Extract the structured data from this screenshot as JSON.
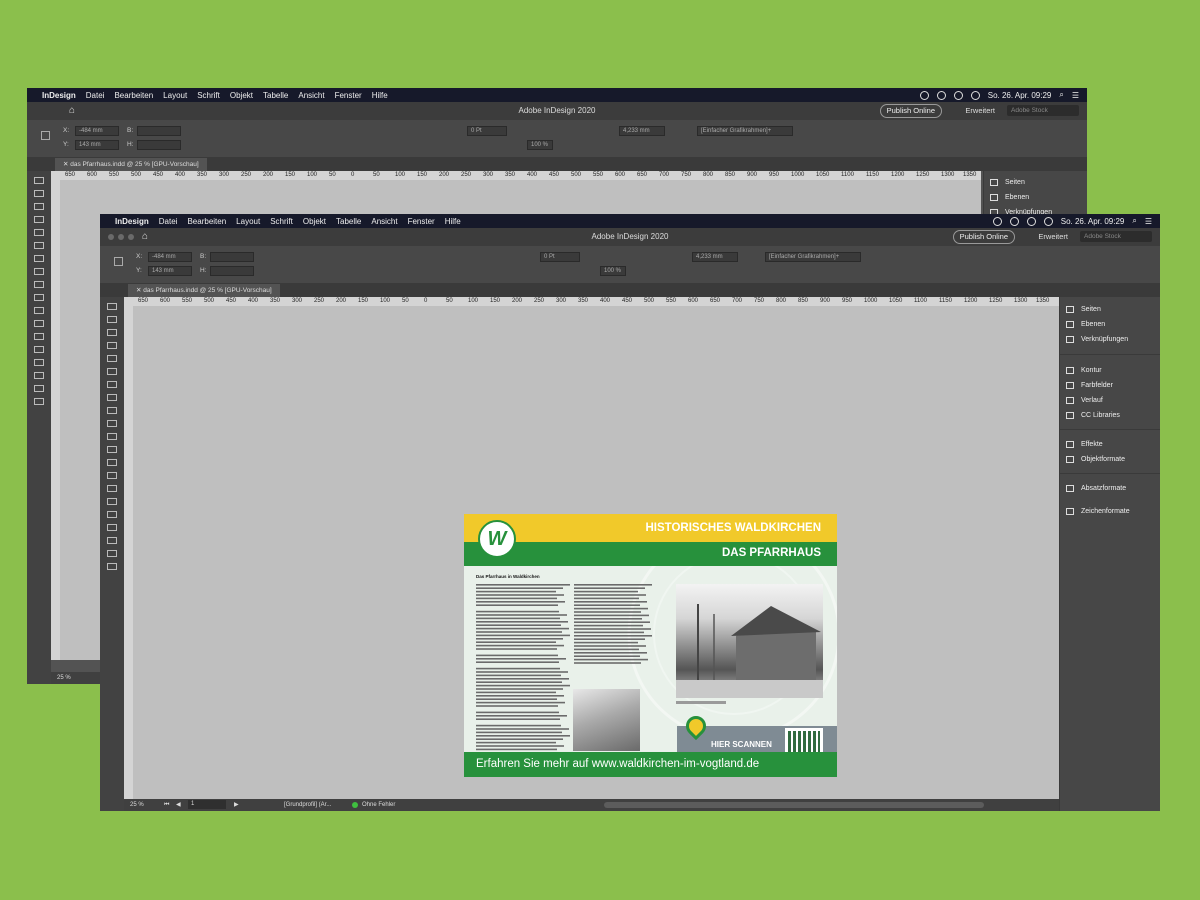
{
  "menubar": {
    "app": "InDesign",
    "items": [
      "Datei",
      "Bearbeiten",
      "Layout",
      "Schrift",
      "Objekt",
      "Tabelle",
      "Ansicht",
      "Fenster",
      "Hilfe"
    ],
    "clock": "So. 26. Apr.  09:29"
  },
  "titlebar": {
    "title": "Adobe InDesign 2020",
    "publish": "Publish Online",
    "workspace": "Erweitert",
    "search_placeholder": "Adobe Stock"
  },
  "control": {
    "x_label": "X:",
    "x_value": "-484 mm",
    "y_label": "Y:",
    "y_value": "143 mm",
    "w_label": "B:",
    "h_label": "H:",
    "stroke_weight": "0 Pt",
    "zoom_box": "100 %",
    "gap": "4,233 mm",
    "object_style": "[Einfacher Grafikrahmen]+"
  },
  "document_tab": "das Pfarrhaus.indd @ 25 % [GPU-Vorschau]",
  "ruler_ticks": [
    "650",
    "600",
    "550",
    "500",
    "450",
    "400",
    "350",
    "300",
    "250",
    "200",
    "150",
    "100",
    "50",
    "0",
    "50",
    "100",
    "150",
    "200",
    "250",
    "300",
    "350",
    "400",
    "450",
    "500",
    "550",
    "600",
    "650",
    "700",
    "750",
    "800",
    "850",
    "900",
    "950",
    "1000",
    "1050",
    "1100",
    "1150",
    "1200",
    "1250",
    "1300",
    "1350"
  ],
  "panels_back": [
    "Seiten",
    "Ebenen",
    "Verknüpfungen"
  ],
  "panels_front": [
    "Seiten",
    "Ebenen",
    "Verknüpfungen",
    "Kontur",
    "Farbfelder",
    "Verlauf",
    "CC Libraries",
    "Effekte",
    "Objektformate",
    "Absatzformate",
    "Zeichenformate"
  ],
  "status": {
    "zoom": "25 %",
    "page": "1",
    "profile": "[Grundprofil] (Ar...",
    "preflight": "Ohne Fehler"
  },
  "poster": {
    "title": "HISTORISCHES WALDKIRCHEN",
    "subtitle": "DAS PFARRHAUS",
    "heading": "Das Pfarrhaus in Waldkirchen",
    "logo_letter": "W",
    "scan_label": "HIER SCANNEN",
    "footer": "Erfahren Sie mehr auf www.waldkirchen-im-vogtland.de"
  },
  "colors": {
    "yellow": "#f1c92a",
    "green": "#27913c",
    "background": "#8bbf4c"
  }
}
